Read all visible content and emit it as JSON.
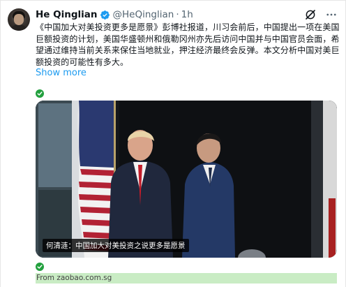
{
  "tweet": {
    "author_name": "He Qinglian",
    "handle": "@HeQinglian",
    "separator": "·",
    "time": "1h",
    "body": "《中国加大对美投资更多是愿景》彭博社报道，川习会前后，中国提出一项在美国巨额投资的计划，美国华盛顿州和俄勒冈州亦先后访问中国并与中国官员会面，希望通过维持当前关系来保住当地就业，押注经济最终会反弹。本文分析中国对美巨额投资的可能性有多大。",
    "show_more": "Show more"
  },
  "media": {
    "caption": "何清涟：中国加大对美投资之说更多是愿景"
  },
  "source": {
    "text": "From zaobao.com.sg"
  },
  "icons": {
    "verified": "verified-badge-icon",
    "grok": "grok-icon",
    "more": "more-options-icon",
    "check": "check-circle-icon"
  },
  "colors": {
    "verified": "#1d9bf0",
    "link": "#1d9bf0",
    "check": "#22a03e",
    "source_bg": "#c9ecc4",
    "muted": "#536471"
  }
}
